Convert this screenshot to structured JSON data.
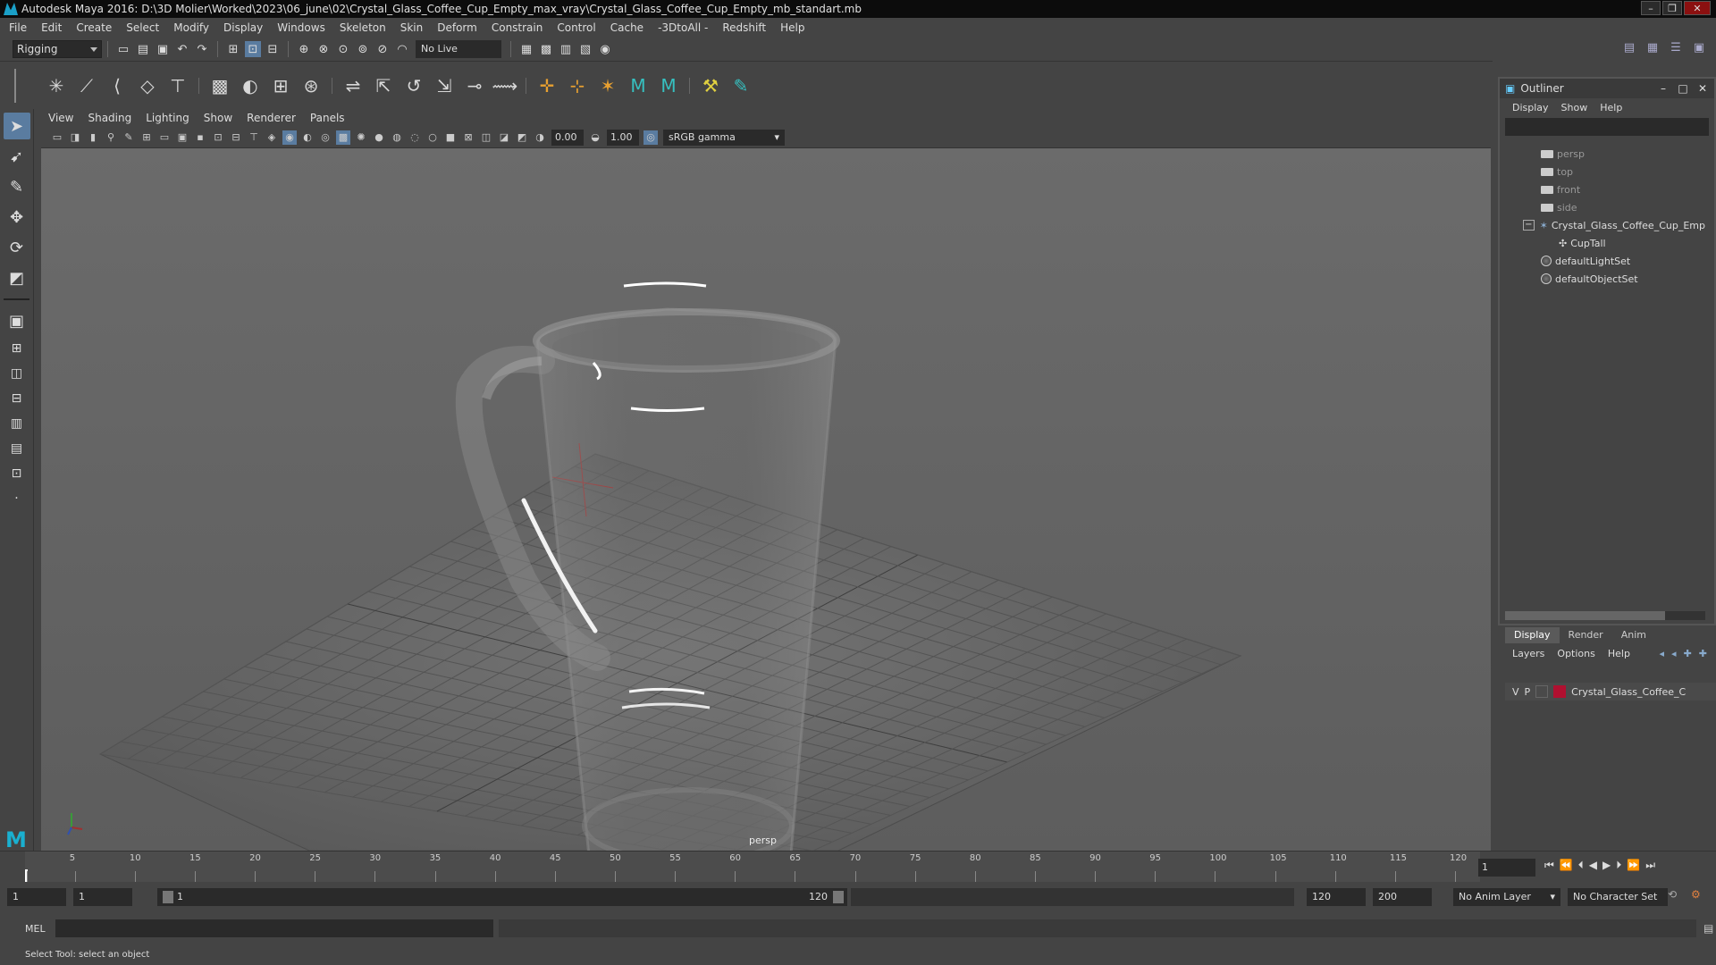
{
  "window": {
    "title": "Autodesk Maya 2016: D:\\3D Molier\\Worked\\2023\\06_june\\02\\Crystal_Glass_Coffee_Cup_Empty_max_vray\\Crystal_Glass_Coffee_Cup_Empty_mb_standart.mb"
  },
  "menubar": [
    "File",
    "Edit",
    "Create",
    "Select",
    "Modify",
    "Display",
    "Windows",
    "Skeleton",
    "Skin",
    "Deform",
    "Constrain",
    "Control",
    "Cache",
    "-3DtoAll -",
    "Redshift",
    "Help"
  ],
  "status_line": {
    "menu_set": "Rigging",
    "live_surface": "No Live Surface"
  },
  "panel": {
    "menus": [
      "View",
      "Shading",
      "Lighting",
      "Show",
      "Renderer",
      "Panels"
    ],
    "exposure": "0.00",
    "gamma_value": "1.00",
    "color_space": "sRGB gamma",
    "camera_label": "persp"
  },
  "outliner": {
    "title": "Outliner",
    "menus": [
      "Display",
      "Show",
      "Help"
    ],
    "items": [
      {
        "label": "persp",
        "icon": "camera-icon"
      },
      {
        "label": "top",
        "icon": "camera-icon"
      },
      {
        "label": "front",
        "icon": "camera-icon"
      },
      {
        "label": "side",
        "icon": "camera-icon"
      },
      {
        "label": "Crystal_Glass_Coffee_Cup_Emp",
        "icon": "group-icon"
      },
      {
        "label": "CupTall",
        "icon": "mesh-icon"
      },
      {
        "label": "defaultLightSet",
        "icon": "set-icon"
      },
      {
        "label": "defaultObjectSet",
        "icon": "set-icon"
      }
    ]
  },
  "layer_editor": {
    "tabs": [
      "Display",
      "Render",
      "Anim"
    ],
    "active_tab": "Display",
    "menus": [
      "Layers",
      "Options",
      "Help"
    ],
    "layer": {
      "v": "V",
      "p": "P",
      "name": "Crystal_Glass_Coffee_C",
      "color": "#b01030"
    }
  },
  "timeline": {
    "labels": [
      "1",
      "5",
      "10",
      "15",
      "20",
      "25",
      "30",
      "35",
      "40",
      "45",
      "50",
      "55",
      "60",
      "65",
      "70",
      "75",
      "80",
      "85",
      "90",
      "95",
      "100",
      "105",
      "110",
      "115",
      "120"
    ],
    "current_frame": "1"
  },
  "range": {
    "start_field": "1",
    "start_playback": "1",
    "slider_start": "1",
    "slider_end": "120",
    "end_playback": "120",
    "end_field": "200",
    "anim_layer": "No Anim Layer",
    "character_set": "No Character Set"
  },
  "command_line": {
    "lang": "MEL"
  },
  "help_line": "Select Tool: select an object"
}
